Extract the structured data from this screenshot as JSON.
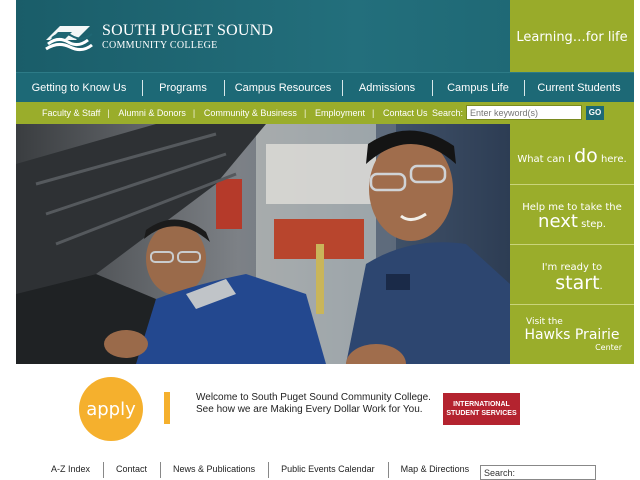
{
  "header": {
    "logo_line1": "SOUTH PUGET SOUND",
    "logo_line2": "COMMUNITY COLLEGE",
    "tagline": "Learning…for life",
    "accent_color": "#99ab2a",
    "brand_color": "#1e6673"
  },
  "main_nav": [
    {
      "label": "Getting to Know Us"
    },
    {
      "label": "Programs"
    },
    {
      "label": "Campus Resources"
    },
    {
      "label": "Admissions"
    },
    {
      "label": "Campus Life"
    },
    {
      "label": "Current Students"
    }
  ],
  "sub_nav": [
    {
      "label": "Faculty & Staff"
    },
    {
      "label": "Alumni & Donors"
    },
    {
      "label": "Community & Business"
    },
    {
      "label": "Employment"
    },
    {
      "label": "Contact Us"
    }
  ],
  "search": {
    "label": "Search:",
    "placeholder": "Enter keyword(s)",
    "go_label": "GO"
  },
  "cta": {
    "c1": {
      "pre": "What can I",
      "big": "do",
      "post": "here."
    },
    "c2": {
      "pre": "Help me to take the",
      "big": "next",
      "post": "step."
    },
    "c3": {
      "pre": "I'm ready to",
      "big": "start",
      "post": "."
    },
    "c4": {
      "pre": "Visit the",
      "big": "Hawks Prairie",
      "post": "Center"
    }
  },
  "welcome": {
    "apply_label": "apply",
    "line1": "Welcome to South Puget Sound Community College.",
    "line2": "See how we are Making Every Dollar Work for You.",
    "intl_line1": "INTERNATIONAL",
    "intl_line2": "STUDENT SERVICES"
  },
  "footer": {
    "links": [
      {
        "label": "A-Z Index"
      },
      {
        "label": "Contact"
      },
      {
        "label": "News & Publications"
      },
      {
        "label": "Public Events Calendar"
      },
      {
        "label": "Map & Directions"
      }
    ],
    "search_value": "Search:"
  },
  "hero": {
    "icon": "hero-photo-students-auto-shop"
  }
}
